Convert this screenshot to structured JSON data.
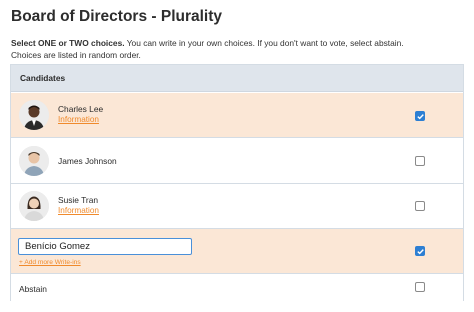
{
  "page": {
    "title": "Board of Directors - Plurality",
    "instruction_bold": "Select ONE or TWO choices.",
    "instruction_rest": " You can write in your own choices. If you don't want to vote, select abstain.",
    "instruction_line2": "Choices are listed in random order."
  },
  "table": {
    "header": "Candidates",
    "candidates": [
      {
        "name": "Charles Lee",
        "link": "Information",
        "selected": true,
        "avatar": "person-avatar-icon"
      },
      {
        "name": "James Johnson",
        "link": "",
        "selected": false,
        "avatar": "person-avatar-icon"
      },
      {
        "name": "Susie Tran",
        "link": "Information",
        "selected": false,
        "avatar": "person-avatar-icon"
      }
    ],
    "writein": {
      "value": "Benício Gomez",
      "selected": true,
      "add_more": "+ Add more Write-ins"
    },
    "abstain": {
      "label": "Abstain",
      "selected": false
    }
  },
  "colors": {
    "selected_row": "#fbe7d6",
    "accent": "#f08a2c",
    "checkbox": "#2d7fd3",
    "header_bg": "#dfe5ec"
  }
}
